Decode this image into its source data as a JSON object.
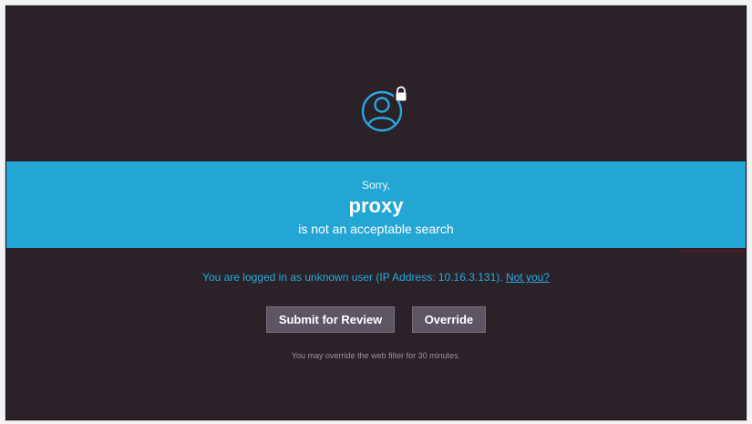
{
  "banner": {
    "sorry": "Sorry,",
    "term": "proxy",
    "message": "is not an acceptable search"
  },
  "login": {
    "text": "You are logged in as unknown user (IP Address: 10.16.3.131).",
    "not_you_link": "Not you?"
  },
  "buttons": {
    "submit_label": "Submit for Review",
    "override_label": "Override"
  },
  "note": "You may override the web filter for 30 minutes.",
  "colors": {
    "background": "#2a2228",
    "banner": "#24a6d4",
    "link": "#2aa7e0",
    "button": "#5d5562"
  },
  "icons": {
    "avatar": "user-lock-icon"
  }
}
